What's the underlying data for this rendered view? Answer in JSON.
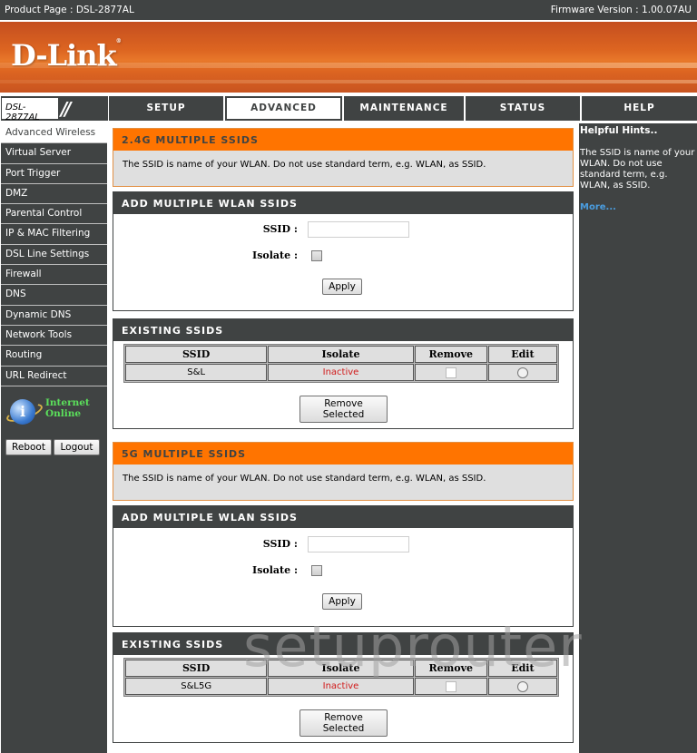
{
  "topbar": {
    "product": "Product Page : DSL-2877AL",
    "firmware": "Firmware Version :  1.00.07AU"
  },
  "banner": {
    "logo": "D-Link",
    "logo_mark": "®"
  },
  "nav": {
    "model": "DSL-2877AL",
    "tabs": [
      {
        "label": "SETUP",
        "active": false
      },
      {
        "label": "ADVANCED",
        "active": true
      },
      {
        "label": "MAINTENANCE",
        "active": false
      },
      {
        "label": "STATUS",
        "active": false
      },
      {
        "label": "HELP",
        "active": false
      }
    ]
  },
  "sidebar": {
    "items": [
      {
        "label": "Advanced Wireless",
        "active": true
      },
      {
        "label": "Virtual Server"
      },
      {
        "label": "Port Trigger"
      },
      {
        "label": "DMZ"
      },
      {
        "label": "Parental Control"
      },
      {
        "label": "IP & MAC Filtering"
      },
      {
        "label": "DSL Line Settings"
      },
      {
        "label": "Firewall"
      },
      {
        "label": "DNS"
      },
      {
        "label": "Dynamic DNS"
      },
      {
        "label": "Network Tools"
      },
      {
        "label": "Routing"
      },
      {
        "label": "URL Redirect"
      }
    ],
    "status_line1": "Internet",
    "status_line2": "Online",
    "reboot": "Reboot",
    "logout": "Logout"
  },
  "band24": {
    "title": "2.4G MULTIPLE SSIDS",
    "desc": "The SSID is name of your WLAN. Do not use standard term, e.g. WLAN, as SSID.",
    "add_title": "ADD MULTIPLE WLAN SSIDS",
    "ssid_label": "SSID :",
    "ssid_value": "",
    "isolate_label": "Isolate :",
    "apply": "Apply",
    "existing_title": "EXISTING SSIDS",
    "columns": [
      "SSID",
      "Isolate",
      "Remove",
      "Edit"
    ],
    "rows": [
      {
        "ssid": "S&L",
        "isolate": "Inactive"
      }
    ],
    "remove_selected": "Remove Selected"
  },
  "band5": {
    "title": "5G MULTIPLE SSIDS",
    "desc": "The SSID is name of your WLAN. Do not use standard term, e.g. WLAN, as SSID.",
    "add_title": "ADD MULTIPLE WLAN SSIDS",
    "ssid_label": "SSID :",
    "ssid_value": "",
    "isolate_label": "Isolate :",
    "apply": "Apply",
    "existing_title": "EXISTING SSIDS",
    "columns": [
      "SSID",
      "Isolate",
      "Remove",
      "Edit"
    ],
    "rows": [
      {
        "ssid": "S&L5G",
        "isolate": "Inactive"
      }
    ],
    "remove_selected": "Remove Selected"
  },
  "help": {
    "title": "Helpful Hints..",
    "text": "The SSID is name of your WLAN. Do not use standard term, e.g. WLAN, as SSID.",
    "more": "More..."
  },
  "watermark": "setuprouter"
}
